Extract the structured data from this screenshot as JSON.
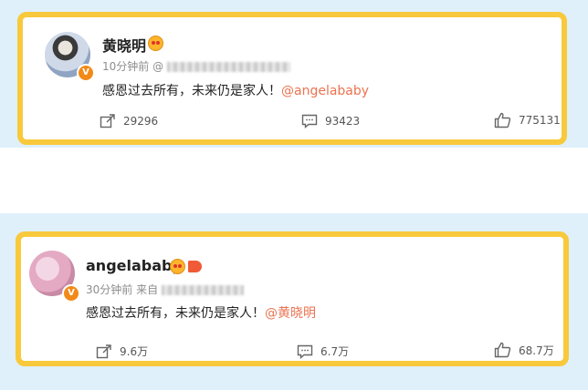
{
  "posts": [
    {
      "author": "黄晓明",
      "time": "10分钟前",
      "source_prefix": "@",
      "text": "感恩过去所有，未来仍是家人！",
      "mention": "@angelababy",
      "reposts": "29296",
      "comments": "93423",
      "likes": "775131",
      "verified_badge": "V"
    },
    {
      "author": "angelababy",
      "time": "30分钟前",
      "source_prefix": "来自",
      "text": "感恩过去所有，未来仍是家人！",
      "mention": "@黄晓明",
      "reposts": "9.6万",
      "comments": "6.7万",
      "likes": "68.7万",
      "verified_badge": "V"
    }
  ],
  "colors": {
    "card_border": "#f8c93c",
    "mention": "#eb7350",
    "background": "#dff0fb"
  }
}
